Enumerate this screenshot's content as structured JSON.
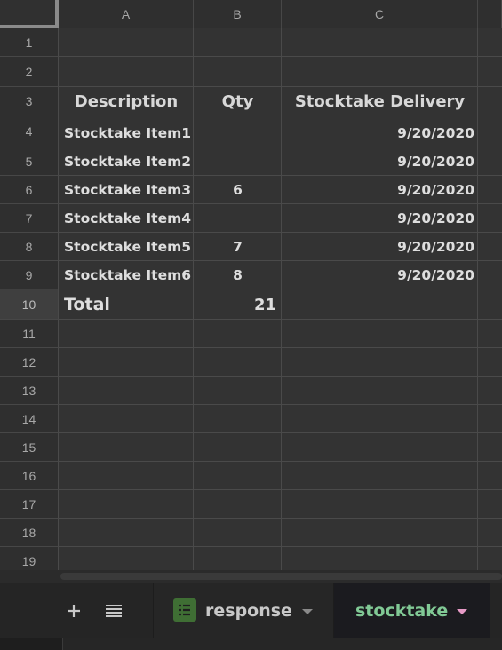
{
  "columns": [
    "A",
    "B",
    "C"
  ],
  "rows": [
    "1",
    "2",
    "3",
    "4",
    "5",
    "6",
    "7",
    "8",
    "9",
    "10",
    "11",
    "12",
    "13",
    "14",
    "15",
    "16",
    "17",
    "18",
    "19"
  ],
  "table": {
    "headers": {
      "description": "Description",
      "qty": "Qty",
      "delivery": "Stocktake Delivery"
    },
    "items": [
      {
        "description": "Stocktake Item1",
        "qty": "",
        "delivery": "9/20/2020"
      },
      {
        "description": "Stocktake Item2",
        "qty": "",
        "delivery": "9/20/2020"
      },
      {
        "description": "Stocktake Item3",
        "qty": "6",
        "delivery": "9/20/2020"
      },
      {
        "description": "Stocktake Item4",
        "qty": "",
        "delivery": "9/20/2020"
      },
      {
        "description": "Stocktake Item5",
        "qty": "7",
        "delivery": "9/20/2020"
      },
      {
        "description": "Stocktake Item6",
        "qty": "8",
        "delivery": "9/20/2020"
      }
    ],
    "total": {
      "label": "Total",
      "value": "21"
    }
  },
  "tabs": {
    "add_icon": "plus-icon",
    "list_icon": "list-icon",
    "sheets": [
      {
        "label": "response",
        "icon": "form-sheet-icon",
        "active": false,
        "color": "#c8c8c8"
      },
      {
        "label": "stocktake",
        "active": true,
        "color": "#81c995",
        "caret_color": "#e79ac6"
      }
    ]
  }
}
